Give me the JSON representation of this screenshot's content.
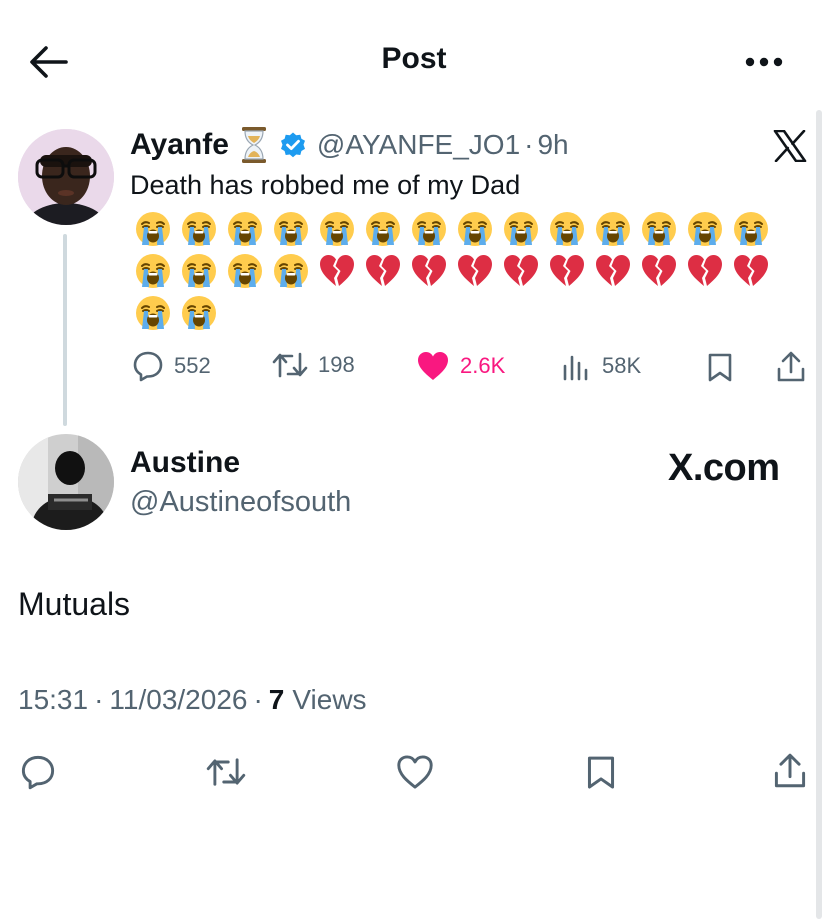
{
  "header": {
    "title": "Post"
  },
  "quoted_post": {
    "display_name": "Ayanfe",
    "handle": "@AYANFE_JO1",
    "separator": "·",
    "time": "9h",
    "text": "Death has robbed me of my Dad",
    "emoji_rows": [
      [
        "crying-face",
        "crying-face",
        "crying-face",
        "crying-face",
        "crying-face",
        "crying-face",
        "crying-face",
        "crying-face",
        "crying-face",
        "crying-face",
        "crying-face",
        "crying-face",
        "crying-face",
        "crying-face"
      ],
      [
        "crying-face",
        "crying-face",
        "crying-face",
        "crying-face",
        "broken-heart",
        "broken-heart",
        "broken-heart",
        "broken-heart",
        "broken-heart",
        "broken-heart",
        "broken-heart",
        "broken-heart",
        "broken-heart",
        "broken-heart"
      ],
      [
        "crying-face",
        "crying-face"
      ]
    ],
    "stats": {
      "replies": "552",
      "reposts": "198",
      "likes": "2.6K",
      "views": "58K"
    },
    "colors": {
      "like": "#f91880",
      "verified": "#1d9bf0"
    }
  },
  "reply_post": {
    "display_name": "Austine",
    "handle": "@Austineofsouth",
    "watermark": "X.com",
    "text": "Mutuals",
    "meta": {
      "time": "15:31",
      "date": "11/03/2026",
      "views_count": "7",
      "views_label": "Views",
      "separator": "·"
    }
  }
}
